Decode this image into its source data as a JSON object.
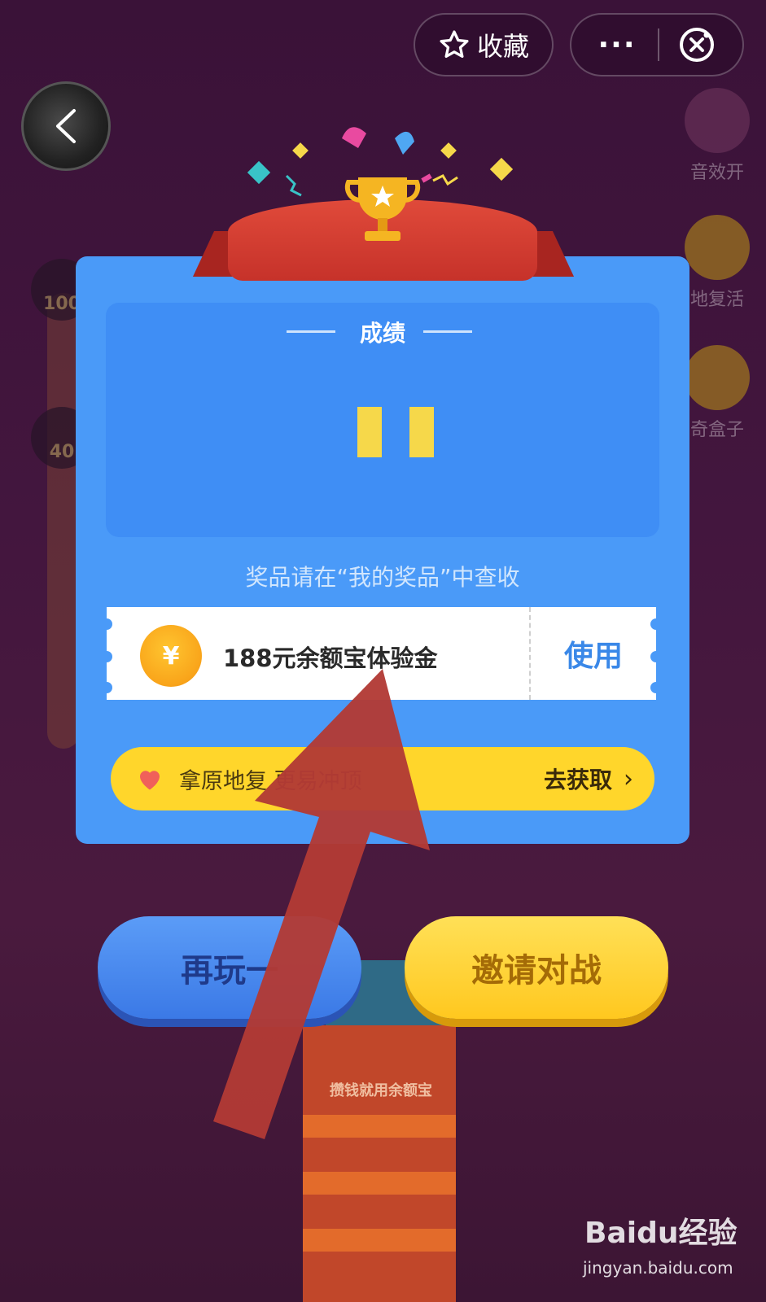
{
  "topbar": {
    "favorite_label": "收藏",
    "more_label": "···"
  },
  "side_tools": {
    "sound_label": "音效开",
    "revive_label": "地复活",
    "box_label": "奇盒子"
  },
  "left_bubbles": [
    "100",
    "40"
  ],
  "result": {
    "title": "成绩",
    "hint": "奖品请在“我的奖品”中查收",
    "prize": {
      "coin_symbol": "¥",
      "name": "188元余额宝体验金",
      "action": "使用"
    },
    "revive_bar": {
      "text": "拿原地复      更易冲顶",
      "cta": "去获取"
    }
  },
  "buttons": {
    "replay": "再玩一",
    "invite": "邀请对战"
  },
  "background": {
    "tower_text": "攒钱就用余额宝"
  },
  "watermark": {
    "brand": "Baidu经验",
    "url": "jingyan.baidu.com"
  },
  "colors": {
    "card": "#4a9af8",
    "accent_yellow": "#ffd62b",
    "use_blue": "#3a88e8",
    "arrow_red": "#b23a35"
  }
}
